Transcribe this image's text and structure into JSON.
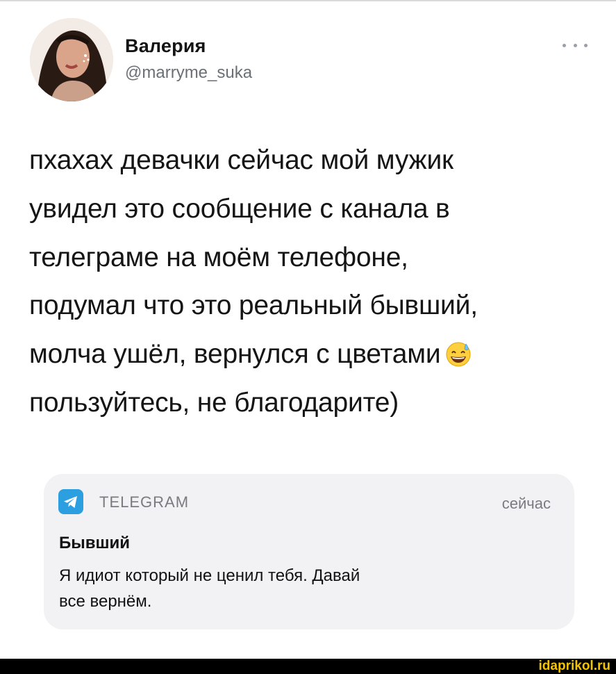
{
  "tweet": {
    "author_name": "Валерия",
    "author_handle": "@marryme_suka",
    "text_lines": [
      "пхахах девачки сейчас мой мужик",
      "увидел это сообщение с канала в",
      "телеграме на моём телефоне,",
      "подумал что это реальный бывший,",
      "молча ушёл, вернулся с цветами",
      "пользуйтесь, не благодарите)"
    ],
    "emoji": "grinning-face-with-sweat"
  },
  "notification": {
    "app_name": "TELEGRAM",
    "time": "сейчас",
    "title": "Бывший",
    "body_lines": [
      "Я идиот который не ценил тебя. Давай",
      "все вернём."
    ]
  },
  "watermark": "idaprikol.ru",
  "icons": {
    "more": "more-dots-icon",
    "telegram": "telegram-icon",
    "emoji": "grinning-sweat-emoji-icon"
  },
  "colors": {
    "telegram_blue": "#2c9fe0",
    "handle_gray": "#6b7076",
    "notification_bg": "#f2f2f4",
    "watermark_yellow": "#f5c400"
  }
}
